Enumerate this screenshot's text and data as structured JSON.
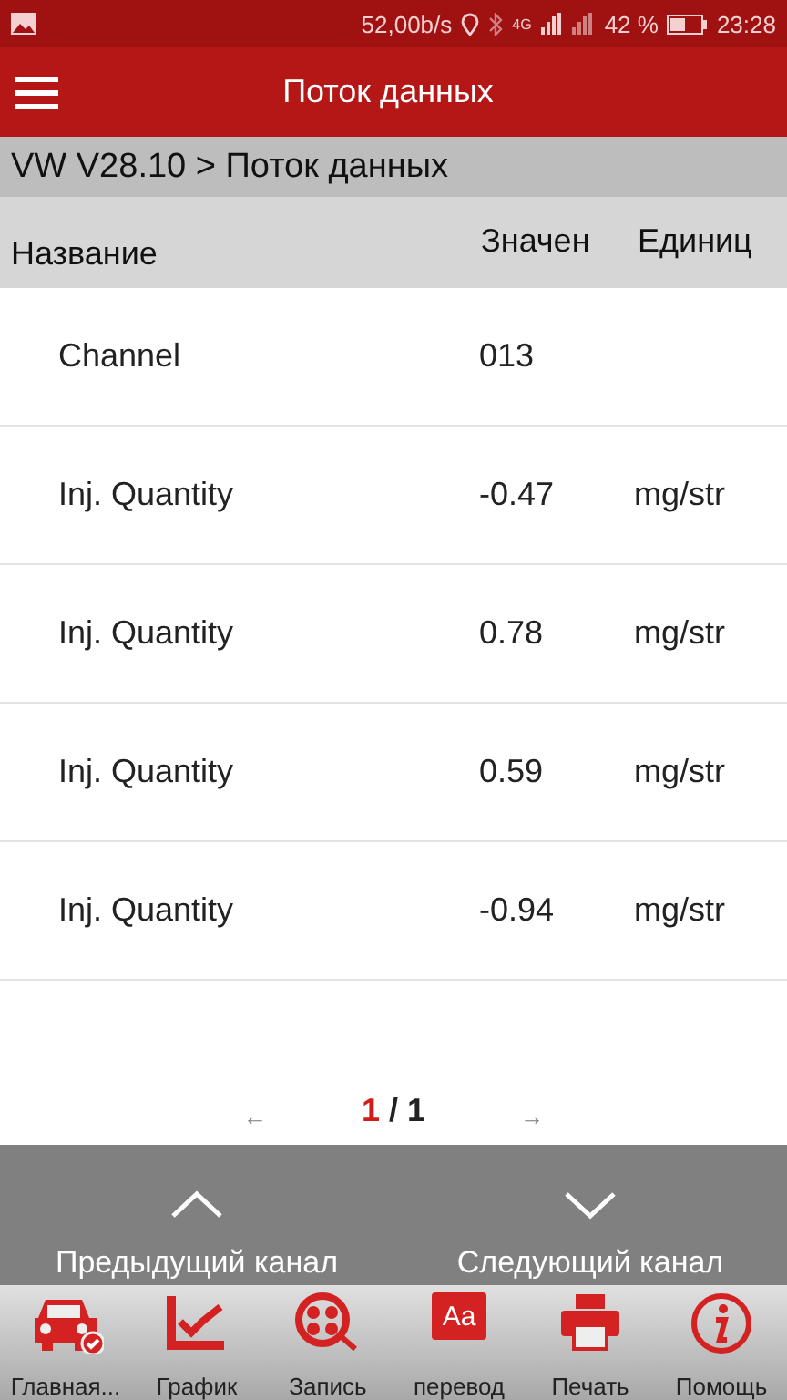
{
  "status_bar": {
    "speed": "52,00b/s",
    "network": "4G",
    "battery": "42 %",
    "time": "23:28"
  },
  "app_bar": {
    "title": "Поток данных"
  },
  "breadcrumb": "VW V28.10 > Поток данных",
  "table": {
    "columns": [
      "Название",
      "Значен",
      "Единиц"
    ],
    "rows": [
      {
        "name": "Channel",
        "value": "013",
        "unit": ""
      },
      {
        "name": "Inj. Quantity",
        "value": "-0.47",
        "unit": "mg/str"
      },
      {
        "name": "Inj. Quantity",
        "value": "0.78",
        "unit": "mg/str"
      },
      {
        "name": "Inj. Quantity",
        "value": "0.59",
        "unit": "mg/str"
      },
      {
        "name": "Inj. Quantity",
        "value": "-0.94",
        "unit": "mg/str"
      }
    ]
  },
  "pagination": {
    "prev": "←",
    "current": "1",
    "total": "/ 1",
    "next": "→"
  },
  "channel_nav": [
    {
      "kind": "prev",
      "label": "Предыдущий канал"
    },
    {
      "kind": "next",
      "label": "Следующий канал"
    }
  ],
  "toolbar": [
    {
      "kind": "car",
      "label": "Главная..."
    },
    {
      "kind": "graph",
      "label": "График"
    },
    {
      "kind": "record",
      "label": "Запись"
    },
    {
      "kind": "translate",
      "label": "перевод",
      "icon_text": "Aa"
    },
    {
      "kind": "print",
      "label": "Печать"
    },
    {
      "kind": "help",
      "label": "Помощь"
    }
  ]
}
